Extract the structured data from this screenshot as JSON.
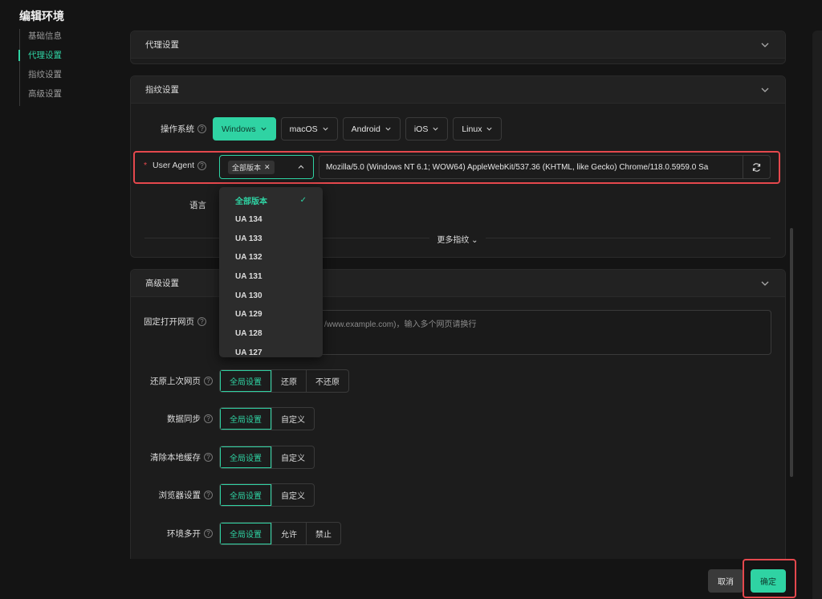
{
  "window": {
    "title": "编辑环境"
  },
  "sidebar": {
    "items": [
      {
        "label": "基础信息"
      },
      {
        "label": "代理设置"
      },
      {
        "label": "指纹设置"
      },
      {
        "label": "高级设置"
      }
    ],
    "active_index": 1
  },
  "proxy": {
    "title": "代理设置"
  },
  "fingerprint": {
    "title": "指纹设置",
    "os_label": "操作系统",
    "os_options": [
      {
        "label": "Windows"
      },
      {
        "label": "macOS"
      },
      {
        "label": "Android"
      },
      {
        "label": "iOS"
      },
      {
        "label": "Linux"
      }
    ],
    "os_selected": "Windows",
    "ua_label": "User Agent",
    "ua_required_mark": "*",
    "ua_tag": "全部版本",
    "ua_value": "Mozilla/5.0 (Windows NT 6.1; WOW64) AppleWebKit/537.36 (KHTML, like Gecko) Chrome/118.0.5959.0 Sa",
    "language_label": "语言",
    "more_label": "更多指纹"
  },
  "ua_dropdown": {
    "options": [
      "全部版本",
      "UA 134",
      "UA 133",
      "UA 132",
      "UA 131",
      "UA 130",
      "UA 129",
      "UA 128",
      "UA 127"
    ],
    "selected": "全部版本"
  },
  "advanced": {
    "title": "高级设置",
    "fixed_pages": {
      "label": "固定打开网页",
      "placeholder": "/www.example.com)，输入多个网页请换行"
    },
    "restore": {
      "label": "还原上次网页",
      "options": [
        "全局设置",
        "还原",
        "不还原"
      ],
      "selected": "全局设置"
    },
    "sync": {
      "label": "数据同步",
      "options": [
        "全局设置",
        "自定义"
      ],
      "selected": "全局设置"
    },
    "clear_cache": {
      "label": "清除本地缓存",
      "options": [
        "全局设置",
        "自定义"
      ],
      "selected": "全局设置"
    },
    "browser": {
      "label": "浏览器设置",
      "options": [
        "全局设置",
        "自定义"
      ],
      "selected": "全局设置"
    },
    "multi_open": {
      "label": "环境多开",
      "options": [
        "全局设置",
        "允许",
        "禁止"
      ],
      "selected": "全局设置"
    }
  },
  "footer": {
    "cancel": "取消",
    "confirm": "确定"
  },
  "colors": {
    "accent": "#2fd3a3",
    "highlight": "#e5484d",
    "background": "#141414"
  }
}
